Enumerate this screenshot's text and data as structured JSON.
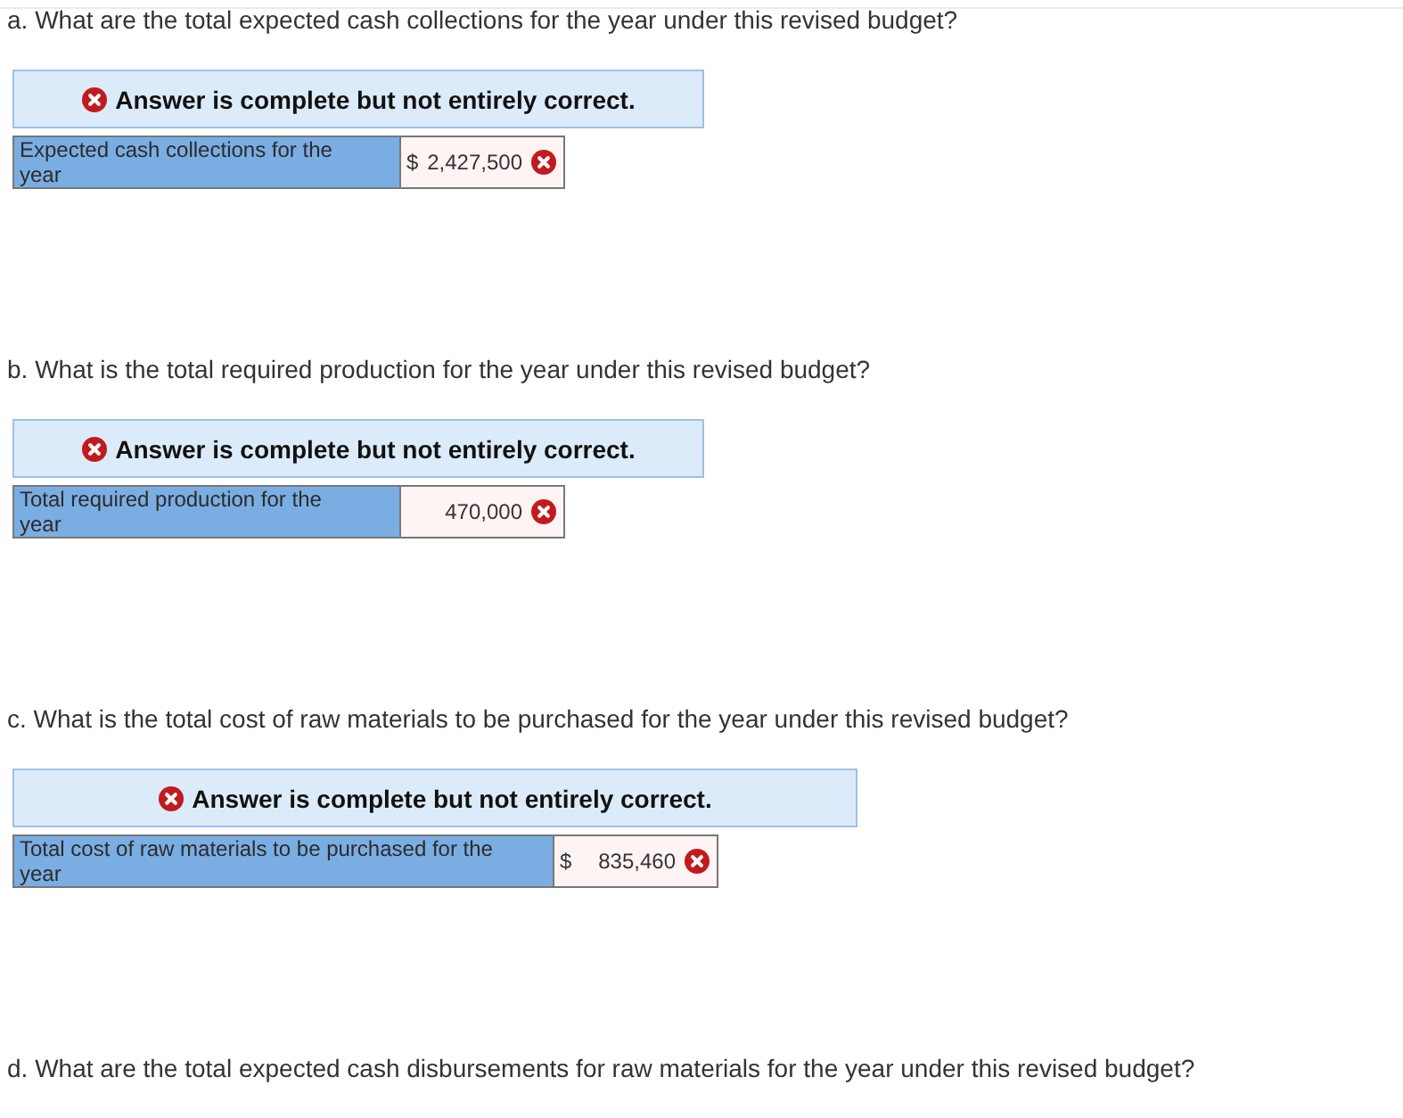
{
  "questions": [
    {
      "text": "a. What are the total expected cash collections for the year under this revised budget?",
      "feedback": {
        "correct": false,
        "text": "Answer is complete but not entirely correct."
      },
      "answer": {
        "label": "Expected cash collections for the year",
        "currency": "$",
        "value": "2,427,500",
        "correct": false
      }
    },
    {
      "text": "b. What is the total required production for the year under this revised budget?",
      "feedback": {
        "correct": false,
        "text": "Answer is complete but not entirely correct."
      },
      "answer": {
        "label": "Total required production for the year",
        "value": "470,000",
        "correct": false
      }
    },
    {
      "text": "c. What is the total cost of raw materials to be purchased for the year under this revised budget?",
      "feedback": {
        "correct": false,
        "text": "Answer is complete but not entirely correct."
      },
      "answer": {
        "label": "Total cost of raw materials to be purchased for the year",
        "currency": "$",
        "value": "835,460",
        "correct": false
      }
    },
    {
      "text": "d. What are the total expected cash disbursements for raw materials for the year under this revised budget?"
    }
  ]
}
